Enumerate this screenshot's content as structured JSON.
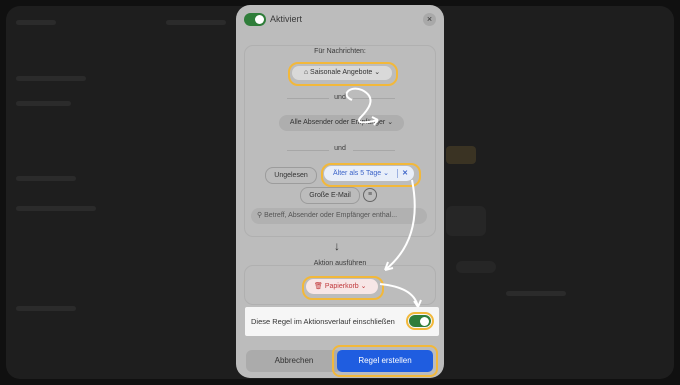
{
  "dialog": {
    "status_label": "Aktiviert",
    "close_symbol": "×",
    "conditions": {
      "section_label": "Für Nachrichten:",
      "category_chip": "Saisonale Angebote",
      "and_label_1": "und",
      "sender_chip": "Alle Absender oder Empfänger",
      "and_label_2": "und",
      "unread_chip": "Ungelesen",
      "age_chip": "Älter als 5 Tage",
      "large_mail_chip": "Große E-Mail",
      "search_placeholder": "Betreff, Absender oder Empfänger enthal..."
    },
    "action": {
      "section_label": "Aktion ausführen",
      "action_chip": "Papierkorb"
    },
    "include_toggle_label": "Diese Regel im Aktionsverlauf einschließen",
    "buttons": {
      "cancel": "Abbrechen",
      "create": "Regel erstellen"
    }
  },
  "colors": {
    "highlight": "#f2b83a",
    "primary_button": "#1f5de0",
    "toggle_on": "#2f7d3a",
    "age_chip_text": "#3b63c8",
    "trash_chip_text": "#c0383b"
  }
}
